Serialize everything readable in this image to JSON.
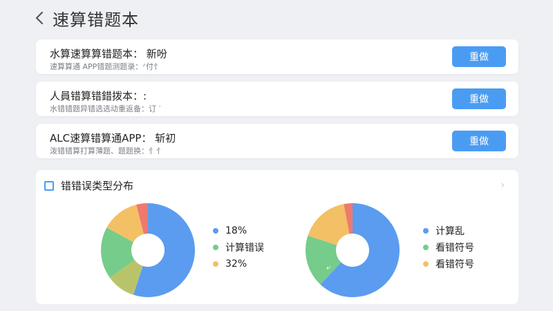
{
  "header": {
    "title": "速算错题本"
  },
  "cards": [
    {
      "title": "水算速算算错题本：  新吩",
      "subtitle": "速算算通 APP错题测题录：ᐟ付忄",
      "button_label": "重做"
    },
    {
      "title": "人員错算错錯拨本：:",
      "subtitle": "水错错题异错选选动重返备：订 ᐝ",
      "button_label": "重做"
    },
    {
      "title": "ALC速算错算通APP：  斩初",
      "subtitle": "泼错错算打算薄题、题题换：忄忄",
      "button_label": "重做"
    },
    {
      "title": "",
      "subtitle": "",
      "button_label": ""
    }
  ],
  "chart_section": {
    "title": "错错误类型分布",
    "colors": {
      "blue": "#5b9cf0",
      "green": "#76cc8a",
      "yellow": "#f3c065",
      "red": "#ee7a6e"
    },
    "chart_data": [
      {
        "type": "pie",
        "series": [
          {
            "values": [
              55,
              10,
              18,
              13,
              4
            ],
            "colors": [
              "#5b9cf0",
              "#b9c46a",
              "#76cc8a",
              "#f3c065",
              "#ee7a6e"
            ]
          }
        ],
        "legend": [
          {
            "label": "18%",
            "color": "#5b9cf0"
          },
          {
            "label": "计算错误",
            "color": "#76cc8a"
          },
          {
            "label": "32%",
            "color": "#f3c065"
          }
        ],
        "legend_position": "right"
      },
      {
        "type": "pie",
        "annotation": "⤶",
        "series": [
          {
            "values": [
              62,
              18,
              17,
              3
            ],
            "colors": [
              "#5b9cf0",
              "#76cc8a",
              "#f3c065",
              "#ee7a6e"
            ]
          }
        ],
        "legend": [
          {
            "label": "计算乱",
            "color": "#5b9cf0"
          },
          {
            "label": "看错符号",
            "color": "#76cc8a"
          },
          {
            "label": "看错符号",
            "color": "#f3c065"
          }
        ],
        "legend_position": "right"
      }
    ]
  }
}
